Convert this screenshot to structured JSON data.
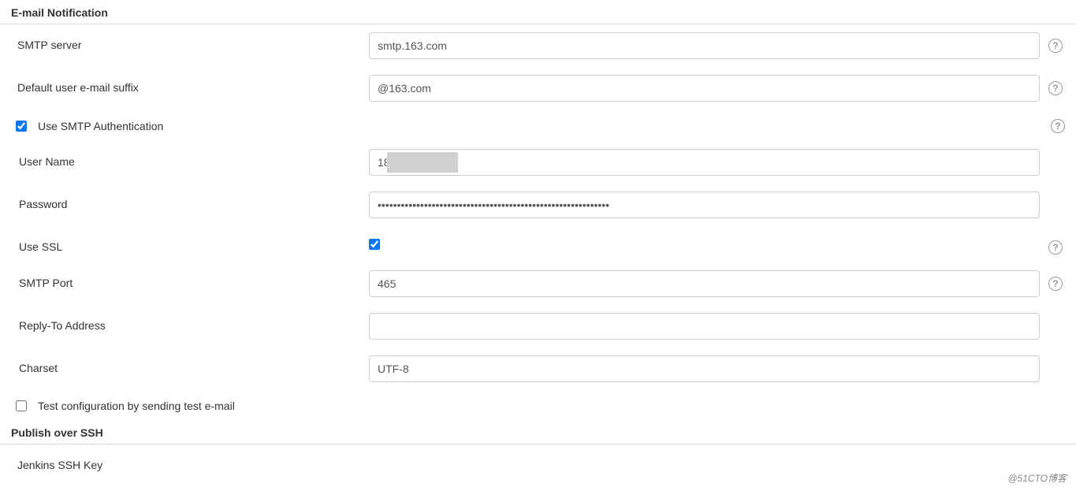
{
  "sections": {
    "email_notification": {
      "title": "E-mail Notification",
      "fields": {
        "smtp_server": {
          "label": "SMTP server",
          "value": "smtp.163.com"
        },
        "default_suffix": {
          "label": "Default user e-mail suffix",
          "value": "@163.com"
        },
        "use_smtp_auth": {
          "label": "Use SMTP Authentication",
          "checked": true
        },
        "user_name": {
          "label": "User Name",
          "value": "18               6"
        },
        "password": {
          "label": "Password",
          "value": "••••••••••••••••••••••••••••••••••••••••••••••••••••••••••••"
        },
        "use_ssl": {
          "label": "Use SSL",
          "checked": true
        },
        "smtp_port": {
          "label": "SMTP Port",
          "value": "465"
        },
        "reply_to": {
          "label": "Reply-To Address",
          "value": ""
        },
        "charset": {
          "label": "Charset",
          "value": "UTF-8"
        },
        "test_config": {
          "label": "Test configuration by sending test e-mail",
          "checked": false
        }
      }
    },
    "publish_over_ssh": {
      "title": "Publish over SSH",
      "fields": {
        "ssh_key": {
          "label": "Jenkins SSH Key"
        }
      }
    }
  },
  "watermark": "@51CTO博客"
}
